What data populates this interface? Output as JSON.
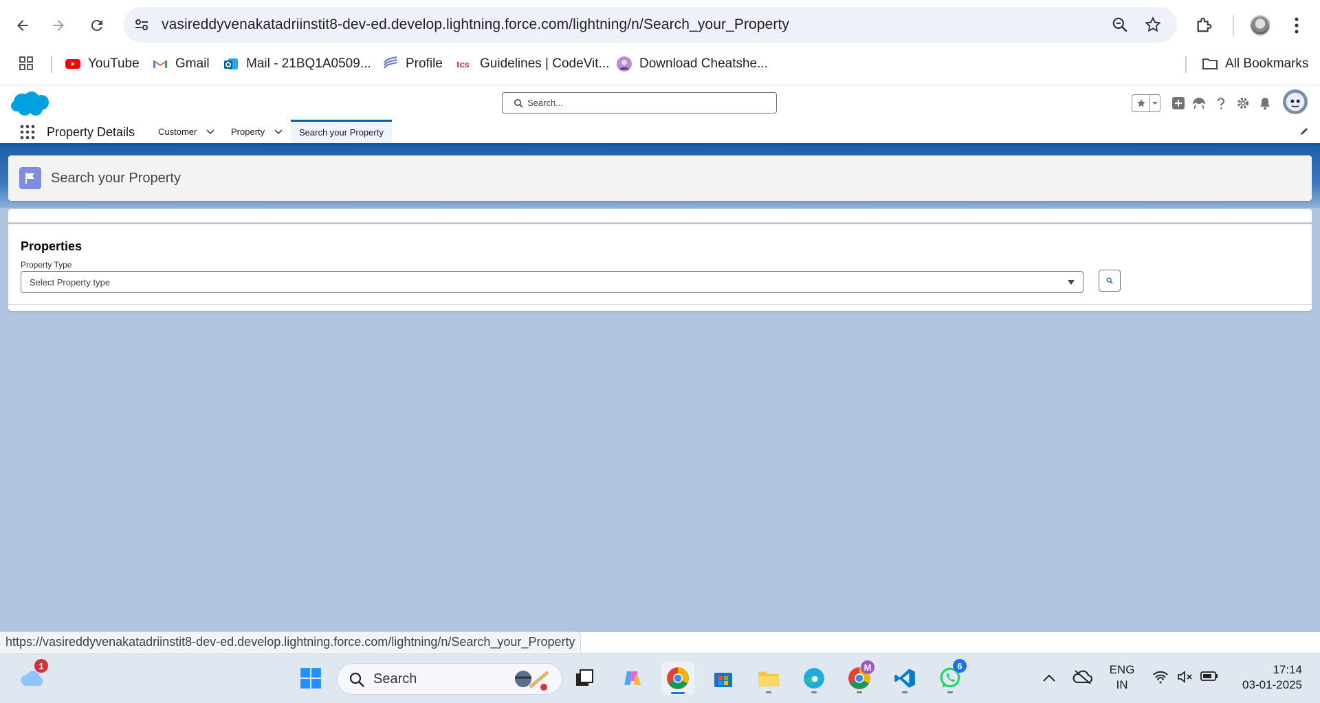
{
  "browser": {
    "url": "vasireddyvenakatadriinstit8-dev-ed.develop.lightning.force.com/lightning/n/Search_your_Property",
    "bookmarks": [
      {
        "label": "YouTube",
        "icon": "youtube-icon"
      },
      {
        "label": "Gmail",
        "icon": "gmail-icon"
      },
      {
        "label": "Mail - 21BQ1A0509...",
        "icon": "outlook-icon"
      },
      {
        "label": "Profile",
        "icon": "profile-icon"
      },
      {
        "label": "Guidelines | CodeVit...",
        "icon": "tcs-icon"
      },
      {
        "label": "Download Cheatshe...",
        "icon": "avatar-icon"
      }
    ],
    "all_bookmarks": "All Bookmarks",
    "status_url": "https://vasireddyvenakatadriinstit8-dev-ed.develop.lightning.force.com/lightning/n/Search_your_Property"
  },
  "salesforce": {
    "search_placeholder": "Search...",
    "app_name": "Property Details",
    "tabs": [
      {
        "label": "Customer",
        "has_menu": true
      },
      {
        "label": "Property",
        "has_menu": true
      },
      {
        "label": "Search your Property",
        "active": true
      }
    ]
  },
  "page": {
    "title": "Search your Property",
    "card_title": "Properties",
    "field_label": "Property Type",
    "combobox_placeholder": "Select Property type"
  },
  "taskbar": {
    "weather_badge": "1",
    "search_label": "Search",
    "whatsapp_badge": "6",
    "chrome_profile_badge": "M",
    "lang_line1": "ENG",
    "lang_line2": "IN",
    "time": "17:14",
    "date": "03-01-2025"
  },
  "colors": {
    "sf_blue": "#0b5cab",
    "content_bg": "#b0c4df",
    "page_icon": "#7f8de1"
  }
}
